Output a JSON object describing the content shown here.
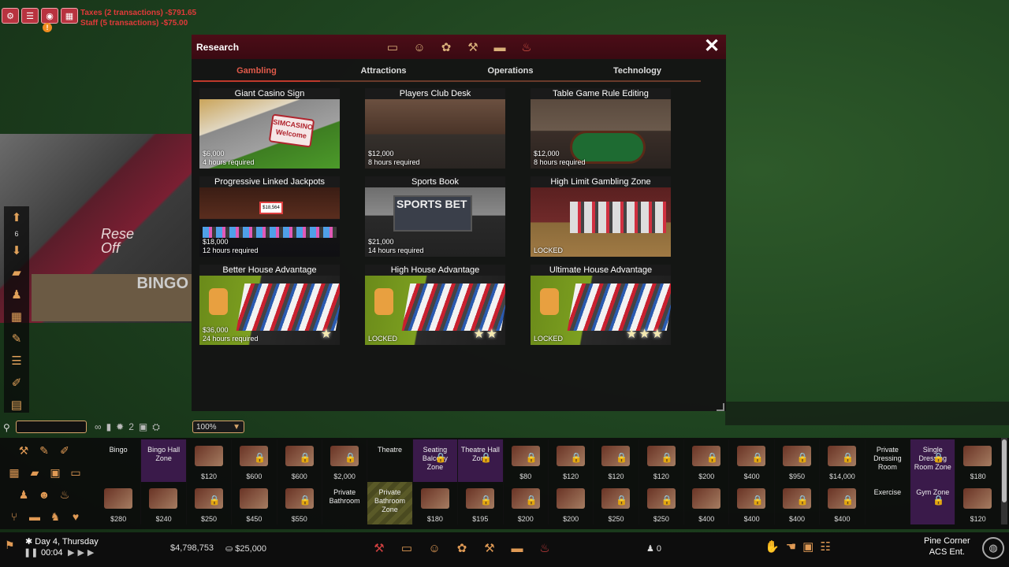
{
  "top_left": {
    "icons": [
      "gear-icon",
      "chat-icon",
      "camera-icon",
      "calendar-icon",
      "eye-icon"
    ],
    "alert_mark": "!",
    "money_log": [
      "Taxes (2 transactions) -$791.65",
      "Staff (5 transactions) -$75.00"
    ]
  },
  "scene": {
    "room_label_1": "Rese",
    "room_label_2": "Off",
    "bingo_sign": "BINGO"
  },
  "left_toolbar": {
    "floor_number": "6",
    "items": [
      "up-arrow-icon",
      "floor-number",
      "down-arrow-icon",
      "box-icon",
      "people-icon",
      "grid-icon",
      "wrench-icon",
      "layers-icon",
      "eyedropper-icon",
      "blueprint-icon"
    ]
  },
  "research": {
    "title": "Research",
    "category_icons": [
      "table-icon",
      "face-icon",
      "chips-icon",
      "tools-icon",
      "truck-icon",
      "fire-extinguisher-icon"
    ],
    "close_label": "✕",
    "tabs": [
      {
        "label": "Gambling",
        "active": true
      },
      {
        "label": "Attractions",
        "active": false
      },
      {
        "label": "Operations",
        "active": false
      },
      {
        "label": "Technology",
        "active": false
      }
    ],
    "cards": [
      {
        "title": "Giant Casino Sign",
        "price": "$6,000",
        "time": "4 hours required",
        "logo_line1": "SIMCASINO",
        "logo_line2": "Welcome",
        "img": "sign"
      },
      {
        "title": "Players Club Desk",
        "price": "$12,000",
        "time": "8 hours required",
        "img": "desk"
      },
      {
        "title": "Table Game Rule Editing",
        "price": "$12,000",
        "time": "8 hours required",
        "img": "table"
      },
      {
        "title": "Progressive Linked Jackpots",
        "price": "$18,000",
        "time": "12 hours required",
        "sign_text": "$18,564",
        "img": "jack"
      },
      {
        "title": "Sports Book",
        "price": "$21,000",
        "time": "14 hours required",
        "board_text": "SPORTS BET",
        "img": "sports"
      },
      {
        "title": "High Limit Gambling Zone",
        "status": "LOCKED",
        "img": "hl"
      },
      {
        "title": "Better House Advantage",
        "price": "$36,000",
        "time": "24 hours required",
        "stars": "★",
        "img": "slots"
      },
      {
        "title": "High House Advantage",
        "status": "LOCKED",
        "stars": "★★",
        "img": "slots"
      },
      {
        "title": "Ultimate House Advantage",
        "status": "LOCKED",
        "stars": "★★★",
        "img": "slots"
      }
    ]
  },
  "build_bar": {
    "search_placeholder": "",
    "tool_icons": [
      "∞",
      "▮",
      "✹",
      "2",
      "▣",
      "⛭"
    ],
    "zoom_value": "100%",
    "row1": [
      {
        "name": "Bingo",
        "price": ""
      },
      {
        "name": "Bingo Hall Zone",
        "price": "",
        "purple": true
      },
      {
        "name": "",
        "price": "$120"
      },
      {
        "name": "",
        "price": "$600",
        "locked": true
      },
      {
        "name": "",
        "price": "$600",
        "locked": true
      },
      {
        "name": "",
        "price": "$2,000",
        "locked": true
      },
      {
        "name": "Theatre",
        "price": ""
      },
      {
        "name": "Seating Balcony Zone",
        "price": "",
        "purple": true,
        "locked": true
      },
      {
        "name": "Theatre Hall Zone",
        "price": "",
        "purple": true,
        "locked": true
      },
      {
        "name": "",
        "price": "$80",
        "locked": true
      },
      {
        "name": "",
        "price": "$120",
        "locked": true
      },
      {
        "name": "",
        "price": "$120",
        "locked": true
      },
      {
        "name": "",
        "price": "$120",
        "locked": true
      },
      {
        "name": "",
        "price": "$200",
        "locked": true
      },
      {
        "name": "",
        "price": "$400",
        "locked": true
      },
      {
        "name": "",
        "price": "$950",
        "locked": true
      },
      {
        "name": "",
        "price": "$14,000",
        "locked": true
      },
      {
        "name": "Private Dressing Room",
        "price": ""
      },
      {
        "name": "Single Dressing Room Zone",
        "price": "",
        "purple": true,
        "locked": true
      },
      {
        "name": "",
        "price": "$180"
      }
    ],
    "row2": [
      {
        "name": "",
        "price": "$280"
      },
      {
        "name": "",
        "price": "$240"
      },
      {
        "name": "",
        "price": "$250",
        "locked": true
      },
      {
        "name": "",
        "price": "$450"
      },
      {
        "name": "",
        "price": "$550",
        "locked": true
      },
      {
        "name": "Private Bathroom",
        "price": ""
      },
      {
        "name": "Private Bathroom Zone",
        "price": "",
        "zone": true
      },
      {
        "name": "",
        "price": "$180"
      },
      {
        "name": "",
        "price": "$195",
        "locked": true
      },
      {
        "name": "",
        "price": "$200",
        "locked": true
      },
      {
        "name": "",
        "price": "$200"
      },
      {
        "name": "",
        "price": "$250",
        "locked": true
      },
      {
        "name": "",
        "price": "$250",
        "locked": true
      },
      {
        "name": "",
        "price": "$400"
      },
      {
        "name": "",
        "price": "$400",
        "locked": true
      },
      {
        "name": "",
        "price": "$400",
        "locked": true
      },
      {
        "name": "",
        "price": "$400",
        "locked": true
      },
      {
        "name": "Exercise",
        "price": ""
      },
      {
        "name": "Gym Zone",
        "price": "",
        "purple": true,
        "locked": true
      },
      {
        "name": "",
        "price": "$120"
      }
    ]
  },
  "status_bar": {
    "date": "Day 4, Thursday",
    "time": "00:04",
    "cash": "$4,798,753",
    "chips": "$25,000",
    "icons": [
      "dealer-icon",
      "table-icon",
      "face-icon",
      "chips-icon",
      "tools-icon",
      "truck-icon",
      "fire-extinguisher-icon"
    ],
    "guests": "0",
    "location_line1": "Pine Corner",
    "location_line2": "ACS Ent."
  }
}
